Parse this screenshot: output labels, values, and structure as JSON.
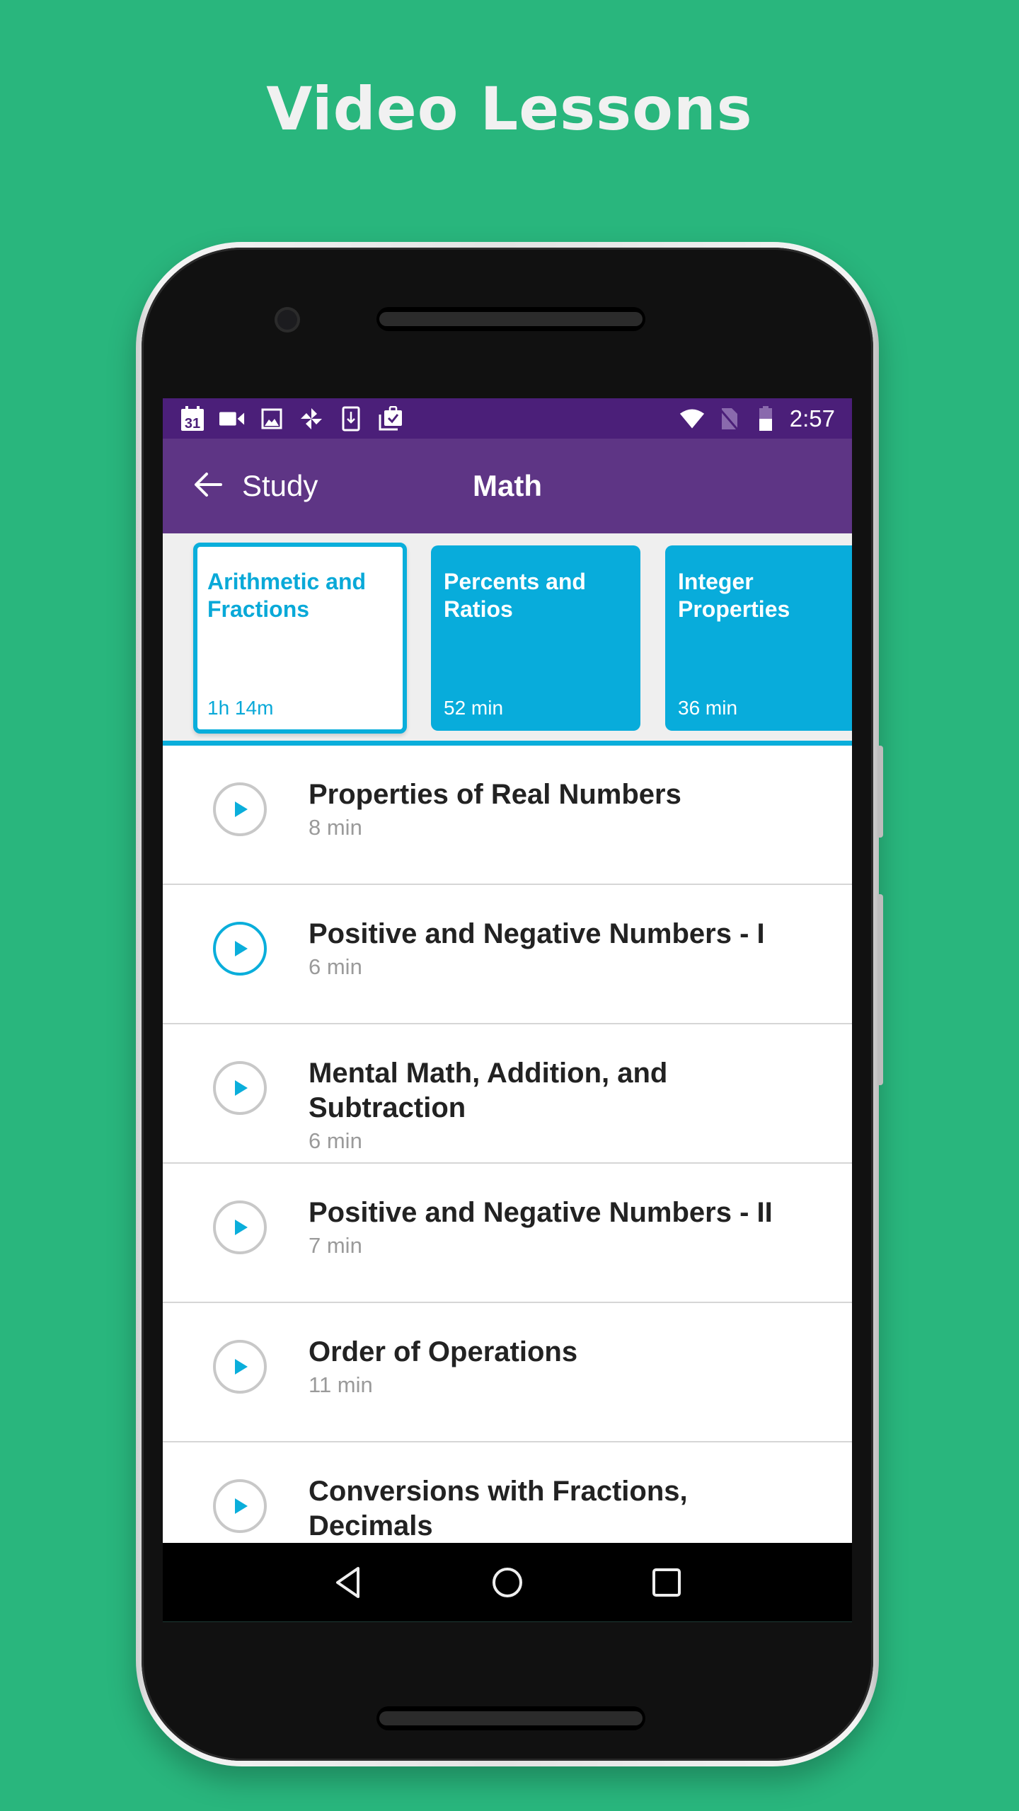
{
  "promo": {
    "title": "Video Lessons"
  },
  "status_bar": {
    "left_icons": [
      "calendar-icon",
      "video-camera-icon",
      "image-icon",
      "pinwheel-icon",
      "download-icon",
      "tasks-icon"
    ],
    "calendar_day": "31",
    "right_icons": [
      "wifi-icon",
      "no-sim-icon",
      "battery-icon"
    ],
    "time": "2:57"
  },
  "app_bar": {
    "back_label": "Study",
    "title": "Math"
  },
  "colors": {
    "background": "#29b67d",
    "status_bar": "#4b1f79",
    "app_bar": "#5e3585",
    "accent": "#0aaedb"
  },
  "categories": [
    {
      "title": "Arithmetic and Fractions",
      "duration": "1h 14m",
      "selected": true
    },
    {
      "title": "Percents and Ratios",
      "duration": "52 min",
      "selected": false
    },
    {
      "title": "Integer Properties",
      "duration": "36 min",
      "selected": false
    }
  ],
  "lessons": [
    {
      "title": "Properties of Real Numbers",
      "duration": "8 min",
      "active": false
    },
    {
      "title": "Positive and Negative Numbers - I",
      "duration": "6 min",
      "active": true
    },
    {
      "title": "Mental Math, Addition, and Subtraction",
      "duration": "6 min",
      "active": false
    },
    {
      "title": "Positive and Negative Numbers - II",
      "duration": "7 min",
      "active": false
    },
    {
      "title": "Order of Operations",
      "duration": "11 min",
      "active": false
    },
    {
      "title": "Conversions with Fractions, Decimals",
      "duration": "",
      "active": false
    }
  ],
  "nav_bar": {
    "buttons": [
      "back-icon",
      "home-icon",
      "recents-icon"
    ]
  }
}
